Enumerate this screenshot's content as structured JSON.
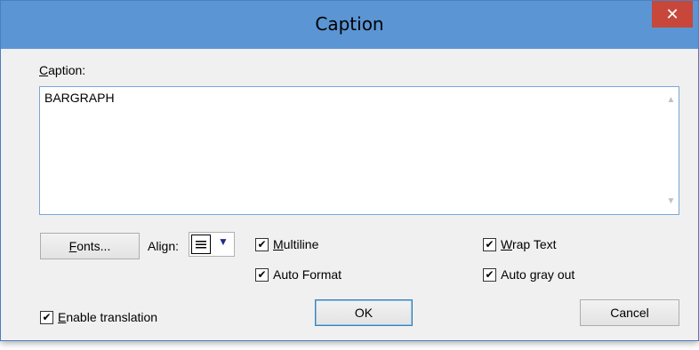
{
  "window": {
    "title": "Caption",
    "close_label": "✕"
  },
  "caption_label": {
    "accel": "C",
    "rest": "aption:"
  },
  "caption_text": "BARGRAPH",
  "buttons": {
    "fonts": {
      "accel": "F",
      "rest": "onts..."
    },
    "ok": "OK",
    "cancel": "Cancel"
  },
  "align": {
    "label": "Align:",
    "selected_icon": "align-justify-icon"
  },
  "checkboxes": {
    "multiline": {
      "accel": "M",
      "rest": "ultiline",
      "checked": true
    },
    "auto_format": {
      "label": "Auto Format",
      "checked": true
    },
    "wrap_text": {
      "accel": "W",
      "rest": "rap Text",
      "checked": true
    },
    "auto_gray_out": {
      "label": "Auto gray out",
      "checked": true
    },
    "enable_translation": {
      "accel": "E",
      "rest": "nable translation",
      "checked": true
    }
  },
  "check_mark": "✔",
  "colors": {
    "titlebar": "#5b95d4",
    "close_button": "#c7473a",
    "dialog_bg": "#f0f0f0",
    "default_button_border": "#3c7fb1"
  }
}
